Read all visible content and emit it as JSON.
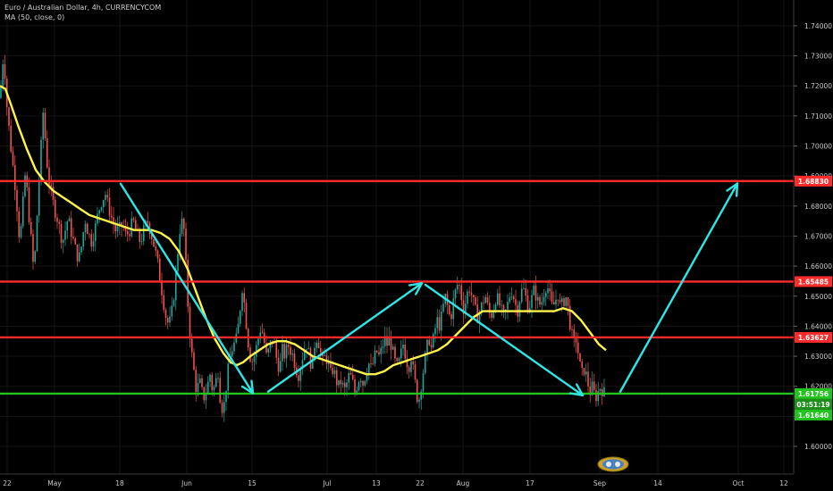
{
  "header": {
    "title": "Euro / Australian Dollar, 4h, CURRENCYCOM",
    "indicator": "MA (50, close, 0)"
  },
  "chart_data": {
    "type": "candlestick",
    "ylim": [
      1.595,
      1.745
    ],
    "y_ticks": [
      "1.60000",
      "1.61000",
      "1.62000",
      "1.63000",
      "1.64000",
      "1.65000",
      "1.66000",
      "1.67000",
      "1.68000",
      "1.69000",
      "1.70000",
      "1.71000",
      "1.72000",
      "1.73000",
      "1.74000"
    ],
    "x_ticks": [
      "22",
      "May",
      "18",
      "Jun",
      "15",
      "Jul",
      "13",
      "22",
      "Aug",
      "17",
      "Sep",
      "14",
      "Oct",
      "12"
    ],
    "price_path": [
      [
        0,
        1.716
      ],
      [
        2,
        1.724
      ],
      [
        4,
        1.731
      ],
      [
        6,
        1.722
      ],
      [
        8,
        1.712
      ],
      [
        10,
        1.706
      ],
      [
        12,
        1.7
      ],
      [
        15,
        1.692
      ],
      [
        18,
        1.684
      ],
      [
        20,
        1.676
      ],
      [
        22,
        1.668
      ],
      [
        24,
        1.674
      ],
      [
        26,
        1.682
      ],
      [
        28,
        1.69
      ],
      [
        30,
        1.686
      ],
      [
        32,
        1.678
      ],
      [
        34,
        1.672
      ],
      [
        36,
        1.664
      ],
      [
        38,
        1.658
      ],
      [
        40,
        1.668
      ],
      [
        42,
        1.68
      ],
      [
        44,
        1.69
      ],
      [
        46,
        1.7
      ],
      [
        48,
        1.712
      ],
      [
        50,
        1.705
      ],
      [
        52,
        1.696
      ],
      [
        55,
        1.688
      ],
      [
        58,
        1.683
      ],
      [
        61,
        1.679
      ],
      [
        64,
        1.676
      ],
      [
        67,
        1.672
      ],
      [
        70,
        1.668
      ],
      [
        73,
        1.672
      ],
      [
        76,
        1.676
      ],
      [
        80,
        1.671
      ],
      [
        84,
        1.666
      ],
      [
        88,
        1.662
      ],
      [
        92,
        1.668
      ],
      [
        95,
        1.676
      ],
      [
        98,
        1.672
      ],
      [
        102,
        1.668
      ],
      [
        106,
        1.672
      ],
      [
        110,
        1.678
      ],
      [
        114,
        1.682
      ],
      [
        118,
        1.684
      ],
      [
        121,
        1.68
      ],
      [
        125,
        1.676
      ],
      [
        129,
        1.672
      ],
      [
        133,
        1.672
      ],
      [
        137,
        1.674
      ],
      [
        141,
        1.67
      ],
      [
        145,
        1.672
      ],
      [
        149,
        1.675
      ],
      [
        153,
        1.671
      ],
      [
        157,
        1.668
      ],
      [
        161,
        1.672
      ],
      [
        165,
        1.675
      ],
      [
        169,
        1.671
      ],
      [
        173,
        1.666
      ],
      [
        177,
        1.66
      ],
      [
        181,
        1.652
      ],
      [
        185,
        1.644
      ],
      [
        189,
        1.64
      ],
      [
        193,
        1.646
      ],
      [
        197,
        1.658
      ],
      [
        201,
        1.672
      ],
      [
        205,
        1.676
      ],
      [
        208,
        1.66
      ],
      [
        211,
        1.643
      ],
      [
        214,
        1.632
      ],
      [
        217,
        1.625
      ],
      [
        220,
        1.618
      ],
      [
        223,
        1.622
      ],
      [
        226,
        1.618
      ],
      [
        229,
        1.616
      ],
      [
        232,
        1.62
      ],
      [
        235,
        1.624
      ],
      [
        238,
        1.618
      ],
      [
        241,
        1.621
      ],
      [
        244,
        1.625
      ],
      [
        247,
        1.614
      ],
      [
        250,
        1.612
      ],
      [
        253,
        1.62
      ],
      [
        256,
        1.627
      ],
      [
        259,
        1.632
      ],
      [
        262,
        1.634
      ],
      [
        265,
        1.636
      ],
      [
        268,
        1.644
      ],
      [
        271,
        1.653
      ],
      [
        274,
        1.646
      ],
      [
        277,
        1.636
      ],
      [
        280,
        1.63
      ],
      [
        283,
        1.628
      ],
      [
        286,
        1.632
      ],
      [
        289,
        1.636
      ],
      [
        292,
        1.64
      ],
      [
        295,
        1.636
      ],
      [
        298,
        1.63
      ],
      [
        301,
        1.632
      ],
      [
        304,
        1.636
      ],
      [
        307,
        1.634
      ],
      [
        310,
        1.628
      ],
      [
        313,
        1.626
      ],
      [
        316,
        1.632
      ],
      [
        319,
        1.63
      ],
      [
        322,
        1.634
      ],
      [
        325,
        1.632
      ],
      [
        328,
        1.63
      ],
      [
        331,
        1.626
      ],
      [
        334,
        1.624
      ],
      [
        337,
        1.628
      ],
      [
        340,
        1.632
      ],
      [
        343,
        1.634
      ],
      [
        346,
        1.63
      ],
      [
        349,
        1.626
      ],
      [
        352,
        1.634
      ],
      [
        355,
        1.637
      ],
      [
        358,
        1.632
      ],
      [
        361,
        1.628
      ],
      [
        364,
        1.63
      ],
      [
        367,
        1.628
      ],
      [
        370,
        1.624
      ],
      [
        373,
        1.626
      ],
      [
        376,
        1.622
      ],
      [
        379,
        1.62
      ],
      [
        382,
        1.622
      ],
      [
        385,
        1.618
      ],
      [
        388,
        1.621
      ],
      [
        391,
        1.624
      ],
      [
        394,
        1.622
      ],
      [
        397,
        1.618
      ],
      [
        400,
        1.621
      ],
      [
        403,
        1.624
      ],
      [
        406,
        1.621
      ],
      [
        409,
        1.624
      ],
      [
        412,
        1.628
      ],
      [
        415,
        1.626
      ],
      [
        418,
        1.628
      ],
      [
        421,
        1.632
      ],
      [
        424,
        1.63
      ],
      [
        427,
        1.632
      ],
      [
        430,
        1.636
      ],
      [
        433,
        1.634
      ],
      [
        436,
        1.636
      ],
      [
        439,
        1.632
      ],
      [
        442,
        1.628
      ],
      [
        445,
        1.626
      ],
      [
        448,
        1.63
      ],
      [
        451,
        1.634
      ],
      [
        454,
        1.63
      ],
      [
        457,
        1.626
      ],
      [
        460,
        1.63
      ],
      [
        463,
        1.624
      ],
      [
        466,
        1.618
      ],
      [
        468,
        1.614
      ],
      [
        471,
        1.62
      ],
      [
        474,
        1.626
      ],
      [
        477,
        1.632
      ],
      [
        480,
        1.636
      ],
      [
        483,
        1.632
      ],
      [
        486,
        1.638
      ],
      [
        489,
        1.642
      ],
      [
        492,
        1.64
      ],
      [
        495,
        1.645
      ],
      [
        498,
        1.65
      ],
      [
        501,
        1.646
      ],
      [
        504,
        1.642
      ],
      [
        507,
        1.648
      ],
      [
        510,
        1.652
      ],
      [
        513,
        1.655
      ],
      [
        516,
        1.65
      ],
      [
        519,
        1.645
      ],
      [
        522,
        1.65
      ],
      [
        525,
        1.653
      ],
      [
        528,
        1.65
      ],
      [
        531,
        1.646
      ],
      [
        534,
        1.643
      ],
      [
        537,
        1.645
      ],
      [
        540,
        1.648
      ],
      [
        543,
        1.65
      ],
      [
        546,
        1.646
      ],
      [
        549,
        1.643
      ],
      [
        552,
        1.646
      ],
      [
        555,
        1.65
      ],
      [
        558,
        1.648
      ],
      [
        561,
        1.645
      ],
      [
        564,
        1.643
      ],
      [
        567,
        1.646
      ],
      [
        570,
        1.65
      ],
      [
        573,
        1.652
      ],
      [
        576,
        1.648
      ],
      [
        579,
        1.645
      ],
      [
        582,
        1.65
      ],
      [
        585,
        1.653
      ],
      [
        588,
        1.65
      ],
      [
        591,
        1.646
      ],
      [
        594,
        1.648
      ],
      [
        597,
        1.652
      ],
      [
        600,
        1.65
      ],
      [
        603,
        1.647
      ],
      [
        606,
        1.648
      ],
      [
        609,
        1.652
      ],
      [
        612,
        1.654
      ],
      [
        615,
        1.65
      ],
      [
        618,
        1.646
      ],
      [
        621,
        1.648
      ],
      [
        624,
        1.651
      ],
      [
        627,
        1.646
      ],
      [
        630,
        1.648
      ],
      [
        633,
        1.65
      ],
      [
        636,
        1.645
      ],
      [
        639,
        1.638
      ],
      [
        642,
        1.634
      ],
      [
        645,
        1.636
      ],
      [
        648,
        1.628
      ],
      [
        651,
        1.624
      ],
      [
        654,
        1.626
      ],
      [
        657,
        1.622
      ],
      [
        660,
        1.618
      ],
      [
        663,
        1.62
      ],
      [
        666,
        1.616
      ],
      [
        669,
        1.618
      ],
      [
        672,
        1.62
      ],
      [
        675,
        1.618
      ],
      [
        678,
        1.6176
      ]
    ],
    "ma_path": [
      [
        0,
        1.72
      ],
      [
        6,
        1.719
      ],
      [
        12,
        1.714
      ],
      [
        20,
        1.707
      ],
      [
        30,
        1.699
      ],
      [
        40,
        1.692
      ],
      [
        50,
        1.688
      ],
      [
        60,
        1.685
      ],
      [
        70,
        1.683
      ],
      [
        80,
        1.681
      ],
      [
        90,
        1.679
      ],
      [
        100,
        1.677
      ],
      [
        110,
        1.676
      ],
      [
        120,
        1.675
      ],
      [
        130,
        1.674
      ],
      [
        140,
        1.673
      ],
      [
        150,
        1.672
      ],
      [
        160,
        1.672
      ],
      [
        170,
        1.672
      ],
      [
        180,
        1.671
      ],
      [
        190,
        1.669
      ],
      [
        200,
        1.665
      ],
      [
        210,
        1.659
      ],
      [
        220,
        1.651
      ],
      [
        230,
        1.643
      ],
      [
        240,
        1.636
      ],
      [
        250,
        1.631
      ],
      [
        258,
        1.628
      ],
      [
        265,
        1.627
      ],
      [
        272,
        1.628
      ],
      [
        280,
        1.63
      ],
      [
        290,
        1.632
      ],
      [
        300,
        1.634
      ],
      [
        310,
        1.635
      ],
      [
        320,
        1.635
      ],
      [
        330,
        1.634
      ],
      [
        340,
        1.632
      ],
      [
        350,
        1.63
      ],
      [
        360,
        1.629
      ],
      [
        370,
        1.628
      ],
      [
        380,
        1.627
      ],
      [
        390,
        1.626
      ],
      [
        400,
        1.625
      ],
      [
        410,
        1.624
      ],
      [
        420,
        1.624
      ],
      [
        430,
        1.625
      ],
      [
        440,
        1.627
      ],
      [
        450,
        1.628
      ],
      [
        460,
        1.629
      ],
      [
        470,
        1.63
      ],
      [
        480,
        1.631
      ],
      [
        490,
        1.632
      ],
      [
        500,
        1.634
      ],
      [
        510,
        1.637
      ],
      [
        520,
        1.64
      ],
      [
        530,
        1.643
      ],
      [
        540,
        1.645
      ],
      [
        550,
        1.645
      ],
      [
        560,
        1.645
      ],
      [
        570,
        1.645
      ],
      [
        580,
        1.645
      ],
      [
        590,
        1.645
      ],
      [
        600,
        1.645
      ],
      [
        610,
        1.645
      ],
      [
        620,
        1.645
      ],
      [
        630,
        1.646
      ],
      [
        640,
        1.645
      ],
      [
        650,
        1.642
      ],
      [
        660,
        1.638
      ],
      [
        670,
        1.634
      ],
      [
        678,
        1.632
      ]
    ],
    "horizontal_levels": [
      {
        "price": 1.6883,
        "label": "1.68830",
        "color": "#ff2a2a"
      },
      {
        "price": 1.65485,
        "label": "1.65485",
        "color": "#ff2a2a"
      },
      {
        "price": 1.63627,
        "label": "1.63627",
        "color": "#ff2a2a"
      },
      {
        "price": 1.61756,
        "label": "1.61756",
        "color": "#22c41e"
      }
    ],
    "current_price_badges": [
      {
        "text": "1.61756",
        "color": "#22c41e"
      },
      {
        "text": "03:51:19",
        "color": "#1f8f1c"
      },
      {
        "text": "1.61640",
        "color": "#22c41e"
      }
    ],
    "arrows": [
      {
        "from": [
          135,
          1.6874
        ],
        "to": [
          283,
          1.6177
        ]
      },
      {
        "from": [
          300,
          1.6182
        ],
        "to": [
          472,
          1.6543
        ]
      },
      {
        "from": [
          476,
          1.6538
        ],
        "to": [
          652,
          1.617
        ]
      },
      {
        "from": [
          694,
          1.6182
        ],
        "to": [
          825,
          1.6875
        ]
      }
    ],
    "colors": {
      "up": "#26a69a",
      "down": "#ef5350",
      "ma": "#fff34a",
      "arrow": "#2ee6e6",
      "grid": "#141414"
    }
  }
}
